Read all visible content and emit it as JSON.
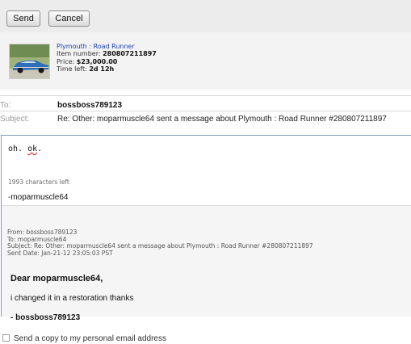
{
  "toolbar": {
    "send_label": "Send",
    "cancel_label": "Cancel"
  },
  "item": {
    "title": "Plymouth : Road Runner",
    "number_label": "Item number:",
    "number_value": "280807211897",
    "price_label": "Price:",
    "price_value": "$23,000.00",
    "time_label": "Time left:",
    "time_value": "2d 12h",
    "thumbnail_icon": "car-photo-icon"
  },
  "recipient": {
    "to_label": "To:",
    "to_value": "bossboss789123",
    "subject_label": "Subject:",
    "subject_value": "Re: Other: moparmuscle64 sent a message about Plymouth : Road Runner #280807211897"
  },
  "compose": {
    "body_start": "oh. ",
    "body_misspelled": "ok",
    "body_end": ".",
    "chars_left": "1993 characters left",
    "signature": "-moparmuscle64"
  },
  "quoted": {
    "from": "From: bossboss789123",
    "to": "To: moparmuscle64",
    "subject": "Subject: Re: Other: moparmuscle64 sent a message about Plymouth : Road Runner #280807211897",
    "sent_date": "Sent Date: Jan-21-12 23:05:03 PST",
    "greeting": "Dear moparmuscle64,",
    "body": "i changed it in a restoration thanks",
    "sign_off": "- bossboss789123"
  },
  "options": {
    "send_copy_label": "Send a copy to my personal email address",
    "send_copy_checked": false
  },
  "colors": {
    "link_blue": "#1a3fb3",
    "compose_border": "#7f9db9",
    "spell_red": "#e01010"
  }
}
